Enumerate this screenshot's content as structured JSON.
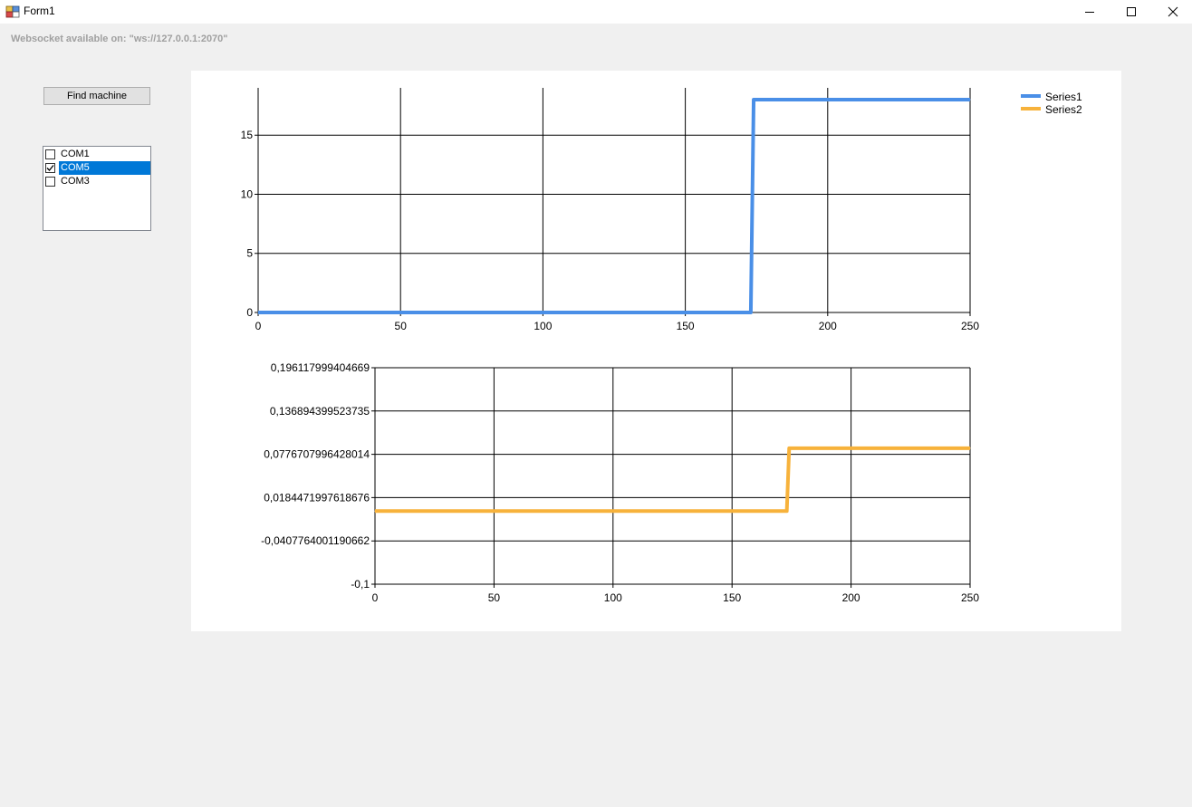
{
  "window": {
    "title": "Form1",
    "controls": [
      "minimize",
      "maximize",
      "close"
    ]
  },
  "status": {
    "websocket_label": "Websocket available on: \"ws://127.0.0.1:2070\""
  },
  "toolbar": {
    "find_machine_label": "Find machine"
  },
  "ports": [
    {
      "label": "COM1",
      "checked": false,
      "selected": false
    },
    {
      "label": "COM5",
      "checked": true,
      "selected": true
    },
    {
      "label": "COM3",
      "checked": false,
      "selected": false
    }
  ],
  "legend": [
    {
      "name": "Series1",
      "color": "#4a8fe7"
    },
    {
      "name": "Series2",
      "color": "#f7b23b"
    }
  ],
  "chart_data": [
    {
      "type": "line",
      "xlim": [
        0,
        250
      ],
      "ylim": [
        0,
        19
      ],
      "x_ticks": [
        "0",
        "50",
        "100",
        "150",
        "200",
        "250"
      ],
      "y_ticks": [
        "0",
        "5",
        "10",
        "15"
      ],
      "grid": true,
      "legend_position": "top-right",
      "series": [
        {
          "name": "Series1",
          "color": "#4a8fe7",
          "x": [
            0,
            173,
            174,
            250
          ],
          "y": [
            0,
            0,
            18,
            18
          ]
        }
      ]
    },
    {
      "type": "line",
      "xlim": [
        0,
        250
      ],
      "ylim": [
        -0.1,
        0.196117999404669
      ],
      "x_ticks": [
        "0",
        "50",
        "100",
        "150",
        "200",
        "250"
      ],
      "y_ticks": [
        "-0,1",
        "-0,0407764001190662",
        "0,0184471997618676",
        "0,0776707996428014",
        "0,136894399523735",
        "0,196117999404669"
      ],
      "grid": true,
      "series": [
        {
          "name": "Series2",
          "color": "#f7b23b",
          "x": [
            0,
            173,
            174,
            250
          ],
          "y": [
            0,
            0,
            0.086,
            0.086
          ]
        }
      ]
    }
  ]
}
